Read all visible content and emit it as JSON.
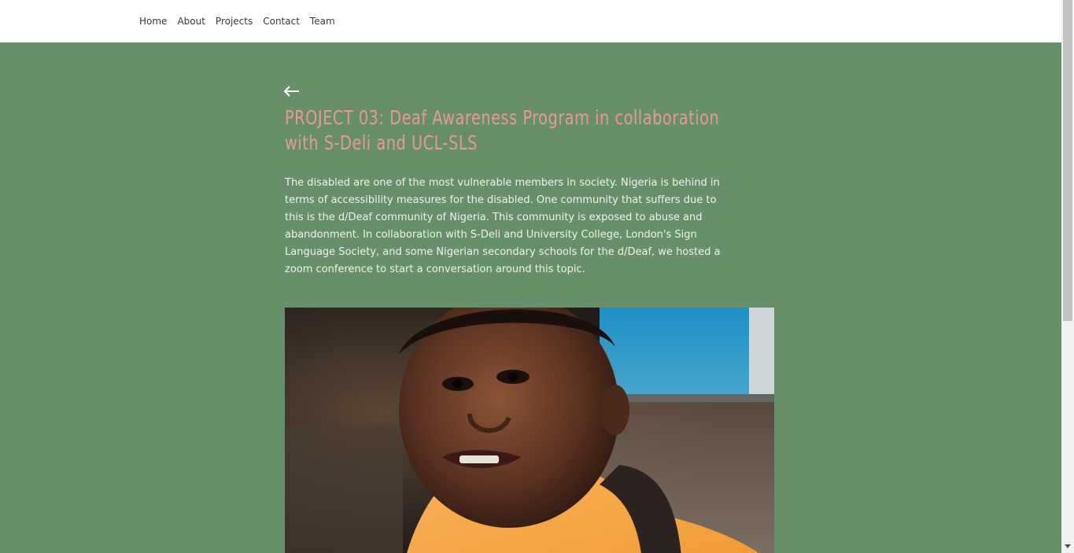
{
  "nav": {
    "items": [
      {
        "label": "Home"
      },
      {
        "label": "About"
      },
      {
        "label": "Projects"
      },
      {
        "label": "Contact"
      },
      {
        "label": "Team"
      }
    ]
  },
  "project": {
    "back_icon": "left-arrow-icon",
    "title": "PROJECT 03: Deaf Awareness Program in collaboration with S-Deli and UCL-SLS",
    "description": "The disabled are one of the most vulnerable members in society. Nigeria is behind in terms of accessibility measures for the disabled. One community that suffers due to this is the d/Deaf community of Nigeria. This community is exposed to abuse and abandonment. In collaboration with S-Deli and University College, London's Sign Language Society, and some Nigerian secondary schools for the d/Deaf, we hosted a zoom conference to start a conversation around this topic.",
    "image_alt": "Portrait of a young boy wearing an orange shirt and a backpack"
  },
  "colors": {
    "background": "#67906a",
    "title": "#e79a91",
    "body_text": "#eef2ee",
    "header_bg": "#ffffff"
  }
}
